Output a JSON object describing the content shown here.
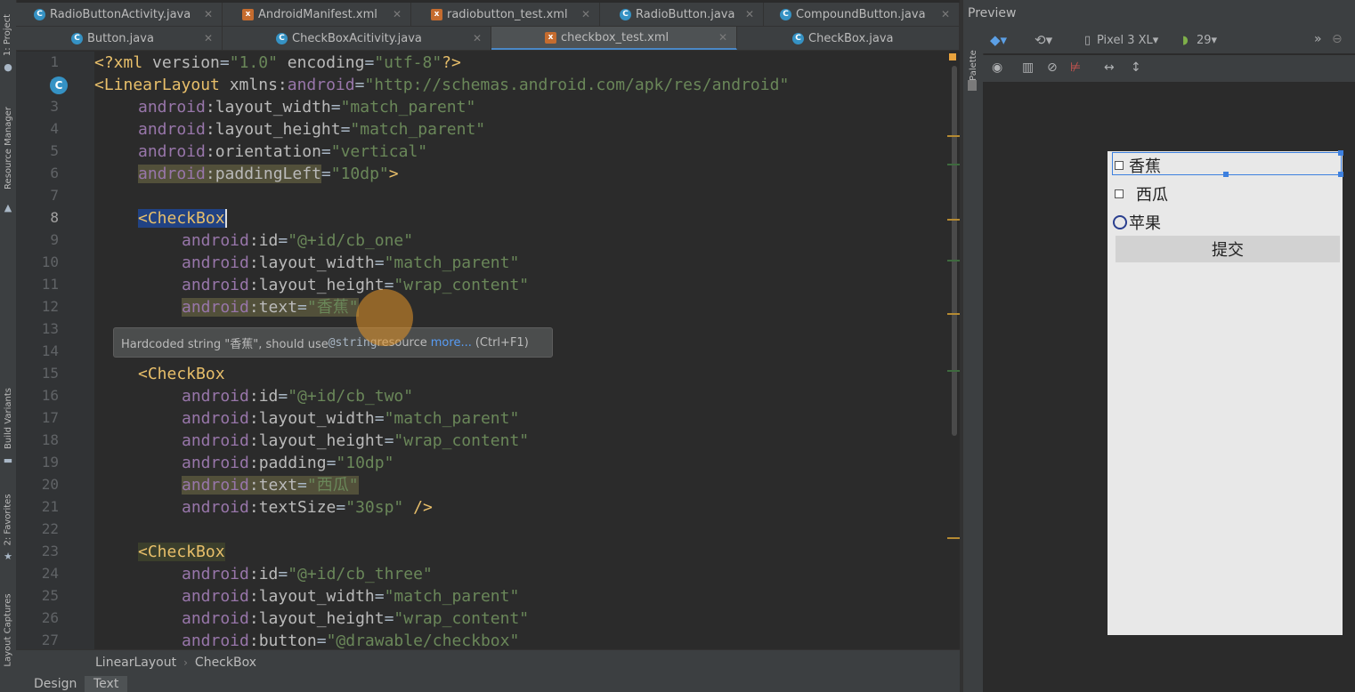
{
  "editor_tabs_row1": [
    {
      "label": "RadioButtonActivity.java",
      "kind": "class"
    },
    {
      "label": "AndroidManifest.xml",
      "kind": "xml"
    },
    {
      "label": "radiobutton_test.xml",
      "kind": "xml"
    },
    {
      "label": "RadioButton.java",
      "kind": "class"
    },
    {
      "label": "CompoundButton.java",
      "kind": "class"
    }
  ],
  "editor_tabs_row2": [
    {
      "label": "Button.java",
      "kind": "class"
    },
    {
      "label": "CheckBoxAcitivity.java",
      "kind": "class"
    },
    {
      "label": "checkbox_test.xml",
      "kind": "xml",
      "active": true
    },
    {
      "label": "CheckBox.java",
      "kind": "class"
    }
  ],
  "left_tool_windows": [
    "1: Project",
    "Resource Manager",
    "Build Variants",
    "2: Favorites",
    "Layout Captures"
  ],
  "line_numbers": [
    "1",
    "2",
    "3",
    "4",
    "5",
    "6",
    "7",
    "8",
    "9",
    "10",
    "11",
    "12",
    "13",
    "14",
    "15",
    "16",
    "17",
    "18",
    "19",
    "20",
    "21",
    "22",
    "23",
    "24",
    "25",
    "26",
    "27"
  ],
  "code": {
    "l1": {
      "a": "<?xml ",
      "b": "version",
      "c": "=",
      "d": "\"1.0\"",
      "e": " encoding",
      "f": "=",
      "g": "\"utf-8\"",
      "h": "?>"
    },
    "l2": {
      "tag": "<LinearLayout ",
      "ns": "xmlns:",
      "nsname": "android",
      "eq": "=",
      "val": "\"http://schemas.android.com/apk/res/android\""
    },
    "l3": {
      "ns": "android",
      "attr": ":layout_width",
      "eq": "=",
      "val": "\"match_parent\""
    },
    "l4": {
      "ns": "android",
      "attr": ":layout_height",
      "eq": "=",
      "val": "\"match_parent\""
    },
    "l5": {
      "ns": "android",
      "attr": ":orientation",
      "eq": "=",
      "val": "\"vertical\""
    },
    "l6": {
      "ns": "android",
      "attr": ":paddingLeft",
      "eq": "=",
      "val": "\"10dp\"",
      "end": ">"
    },
    "l8": {
      "tag": "<CheckBox"
    },
    "l9": {
      "ns": "android",
      "attr": ":id",
      "eq": "=",
      "val": "\"@+id/cb_one\""
    },
    "l10": {
      "ns": "android",
      "attr": ":layout_width",
      "eq": "=",
      "val": "\"match_parent\""
    },
    "l11": {
      "ns": "android",
      "attr": ":layout_height",
      "eq": "=",
      "val": "\"wrap_content\""
    },
    "l12": {
      "ns": "android",
      "attr": ":text",
      "eq": "=",
      "val": "\"香蕉\""
    },
    "l15": {
      "tag": "<CheckBox"
    },
    "l16": {
      "ns": "android",
      "attr": ":id",
      "eq": "=",
      "val": "\"@+id/cb_two\""
    },
    "l17": {
      "ns": "android",
      "attr": ":layout_width",
      "eq": "=",
      "val": "\"match_parent\""
    },
    "l18": {
      "ns": "android",
      "attr": ":layout_height",
      "eq": "=",
      "val": "\"wrap_content\""
    },
    "l19": {
      "ns": "android",
      "attr": ":padding",
      "eq": "=",
      "val": "\"10dp\""
    },
    "l20": {
      "ns": "android",
      "attr": ":text",
      "eq": "=",
      "val": "\"西瓜\""
    },
    "l21": {
      "ns": "android",
      "attr": ":textSize",
      "eq": "=",
      "val": "\"30sp\"",
      "end": " />"
    },
    "l23": {
      "tag": "<CheckBox"
    },
    "l24": {
      "ns": "android",
      "attr": ":id",
      "eq": "=",
      "val": "\"@+id/cb_three\""
    },
    "l25": {
      "ns": "android",
      "attr": ":layout_width",
      "eq": "=",
      "val": "\"match_parent\""
    },
    "l26": {
      "ns": "android",
      "attr": ":layout_height",
      "eq": "=",
      "val": "\"wrap_content\""
    },
    "l27": {
      "ns": "android",
      "attr": ":button",
      "eq": "=",
      "val": "\"@drawable/checkbox\""
    }
  },
  "tooltip": {
    "prefix": "Hardcoded string \"香蕉\", should use ",
    "mono": "@string",
    "suffix": " resource",
    "link": "more...",
    "shortcut": "(Ctrl+F1)"
  },
  "breadcrumb": {
    "first": "LinearLayout",
    "sep": "›",
    "second": "CheckBox"
  },
  "bottom_tabs": {
    "design": "Design",
    "text": "Text",
    "active": "Text"
  },
  "preview": {
    "title": "Preview",
    "palette_label": "Palette",
    "device": "Pixel 3 XL",
    "api_level": "29",
    "checkboxes": [
      "香蕉",
      "西瓜",
      "苹果"
    ],
    "submit_button": "提交"
  },
  "colors": {
    "editor_bg": "#2b2b2b",
    "tag": "#e8bf6a",
    "namespace": "#9876aa",
    "string": "#6a8759",
    "selection": "#3d80df"
  }
}
